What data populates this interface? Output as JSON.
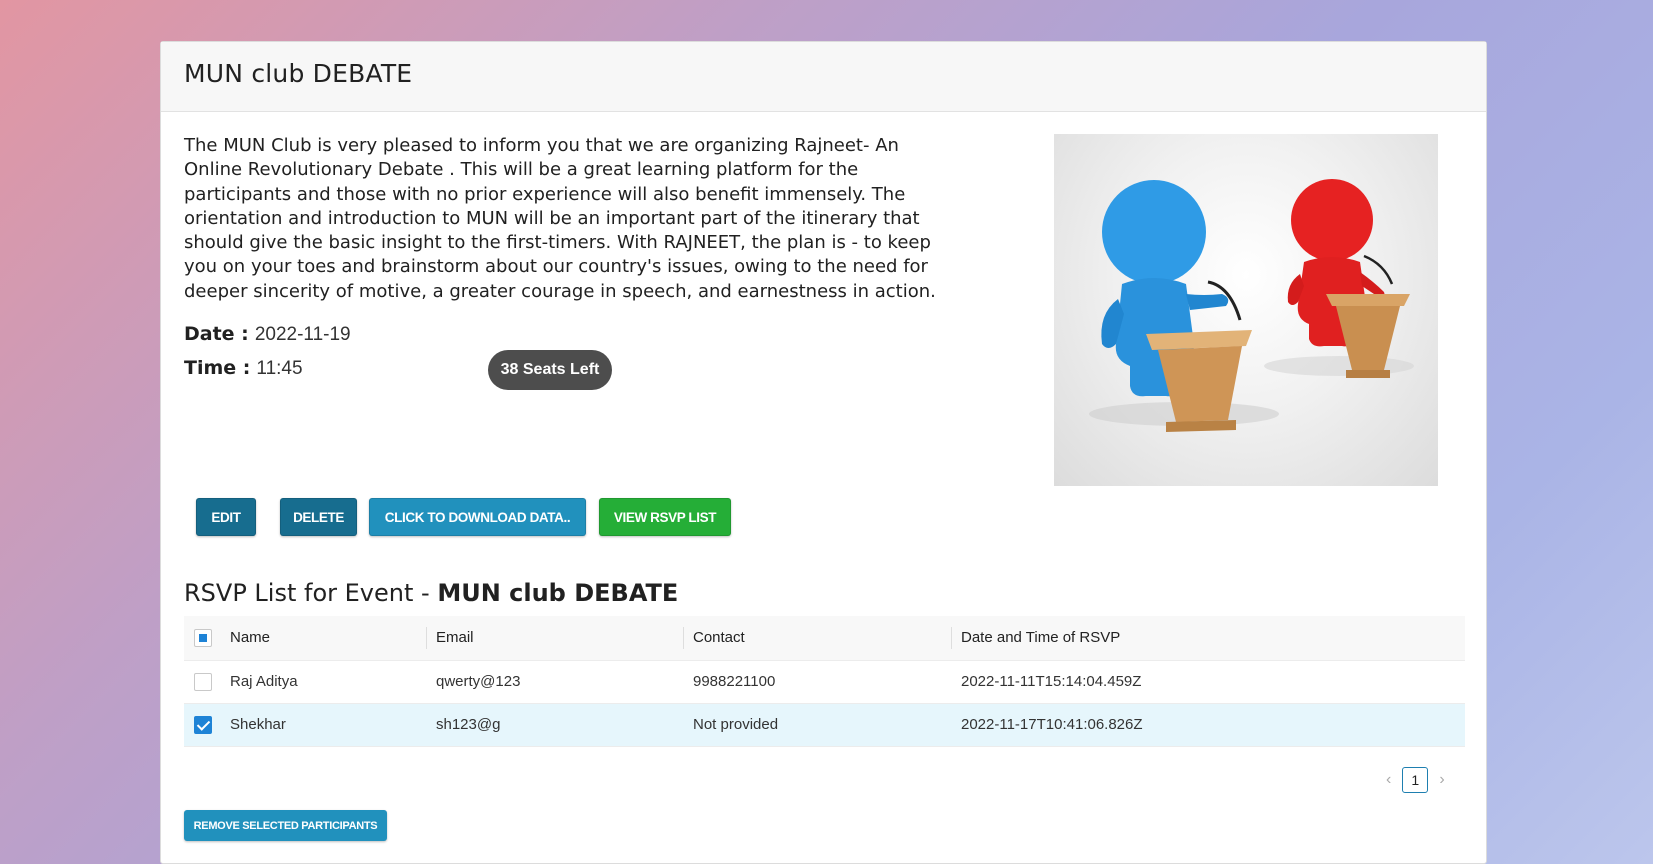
{
  "event": {
    "title": "MUN club DEBATE",
    "description": "The MUN Club is very pleased to inform you that we are organizing Rajneet- An Online Revolutionary Debate . This will be a great learning platform for the participants and those with no prior experience will also benefit immensely. The orientation and introduction to MUN will be an important part of the itinerary that should give the basic insight to the first-timers. With RAJNEET, the plan is - to keep you on your toes and brainstorm about our country's issues, owing to the need for deeper sincerity of motive, a greater courage in speech, and earnestness in action.",
    "date_label": "Date :",
    "date": "2022-11-19",
    "time_label": "Time :",
    "time": "11:45",
    "seats_left": "38 Seats Left"
  },
  "actions": {
    "edit": "EDIT",
    "delete": "DELETE",
    "download": "CLICK TO DOWNLOAD DATA..",
    "view_rsvp": "VIEW RSVP LIST",
    "remove_selected": "REMOVE SELECTED PARTICIPANTS"
  },
  "rsvp": {
    "heading_prefix": "RSVP List for Event -",
    "heading_event": "MUN club DEBATE",
    "columns": [
      "Name",
      "Email",
      "Contact",
      "Date and Time of RSVP"
    ],
    "rows": [
      {
        "name": "Raj Aditya",
        "email": "qwerty@123",
        "contact": "9988221100",
        "rsvp_time": "2022-11-11T15:14:04.459Z",
        "selected": false
      },
      {
        "name": "Shekhar",
        "email": "sh123@g",
        "contact": "Not provided",
        "rsvp_time": "2022-11-17T10:41:06.826Z",
        "selected": true
      }
    ]
  },
  "pagination": {
    "prev_icon": "‹",
    "current_page": "1",
    "next_icon": "›"
  },
  "colors": {
    "primary_dark": "#176d8f",
    "primary": "#2191bd",
    "success": "#25ae37",
    "badge": "#4d4d4d",
    "checkbox": "#1e83d6",
    "selected_row": "#e6f6fc"
  }
}
